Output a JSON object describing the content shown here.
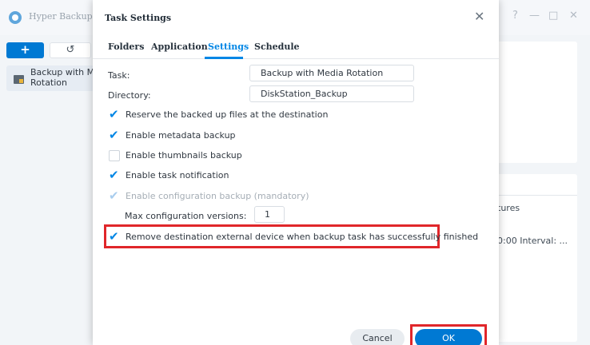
{
  "app": {
    "title": "Hyper Backup",
    "controls": {
      "help": "?",
      "minimize": "—",
      "maximize": "□",
      "close": "✕"
    },
    "add_button": "+",
    "restore_button": "↺",
    "task_item": {
      "label_line1": "Backup with M",
      "label_line2": "Rotation"
    },
    "right_panel_partial": {
      "line1": "tures",
      "line2": "0:00 Interval: ..."
    }
  },
  "dialog": {
    "title": "Task Settings",
    "close": "✕",
    "tabs": [
      {
        "label": "Folders",
        "active": false
      },
      {
        "label": "Application",
        "active": false
      },
      {
        "label": "Settings",
        "active": true
      },
      {
        "label": "Schedule",
        "active": false
      }
    ],
    "task_label": "Task:",
    "task_value": "Backup with Media Rotation",
    "directory_label": "Directory:",
    "directory_value": "DiskStation_Backup",
    "options": [
      {
        "label": "Reserve the backed up files at the destination",
        "checked": true,
        "disabled": false
      },
      {
        "label": "Enable metadata backup",
        "checked": true,
        "disabled": false
      },
      {
        "label": "Enable thumbnails backup",
        "checked": false,
        "disabled": false
      },
      {
        "label": "Enable task notification",
        "checked": true,
        "disabled": false
      },
      {
        "label": "Enable configuration backup (mandatory)",
        "checked": true,
        "disabled": true
      },
      {
        "label": "Remove destination external device when backup task has successfully finished",
        "checked": true,
        "disabled": false
      }
    ],
    "max_versions_label": "Max configuration versions:",
    "max_versions_value": "1",
    "cancel_label": "Cancel",
    "ok_label": "OK"
  },
  "colors": {
    "accent": "#0086e5",
    "primary_button": "#0079d3",
    "highlight_box": "#e0262a"
  }
}
